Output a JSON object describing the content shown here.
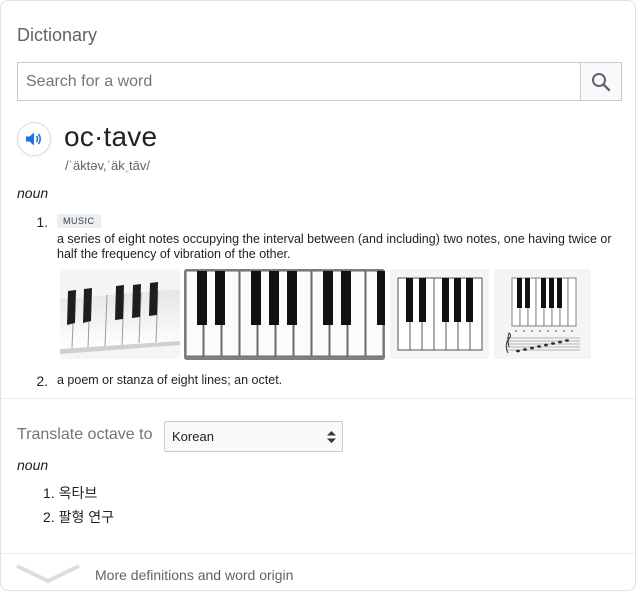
{
  "title": "Dictionary",
  "search": {
    "placeholder": "Search for a word",
    "value": ""
  },
  "entry": {
    "word": "oc·tave",
    "phonetic": "/ˈäktəv,ˈäkˌtāv/",
    "part_of_speech": "noun",
    "senses": [
      {
        "number": "1.",
        "tag": "MUSIC",
        "definition": "a series of eight notes occupying the interval between (and including) two notes, one having twice or half the frequency of vibration of the other."
      },
      {
        "number": "2.",
        "definition": "a poem or stanza of eight lines; an octet."
      }
    ],
    "images": [
      "piano-keys-photo",
      "piano-keyboard-octave",
      "piano-keyboard-diagram",
      "piano-keyboard-staff-notes"
    ]
  },
  "translate": {
    "label": "Translate octave to",
    "language": "Korean",
    "part_of_speech": "noun",
    "items": [
      {
        "number": "1.",
        "text": "옥타브"
      },
      {
        "number": "2.",
        "text": "팔형 연구"
      }
    ]
  },
  "more": {
    "label": "More definitions and word origin"
  },
  "colors": {
    "accent": "#1a73e8",
    "muted": "#5f6368",
    "border": "#dfe1e5"
  },
  "icons": {
    "search": "magnifier-icon",
    "audio": "speaker-icon",
    "expand": "chevron-down-icon"
  }
}
